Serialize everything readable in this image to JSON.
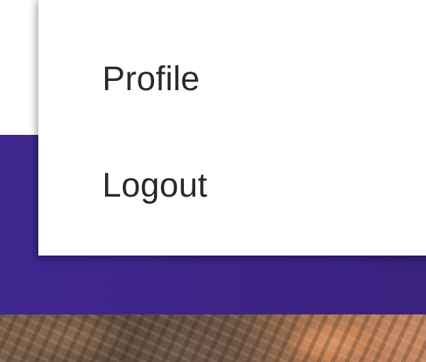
{
  "dropdown": {
    "items": [
      {
        "label": "Profile"
      },
      {
        "label": "Logout"
      }
    ]
  },
  "colors": {
    "header": "#3d2487",
    "menu_background": "#ffffff",
    "menu_text": "#2a2a2a"
  }
}
